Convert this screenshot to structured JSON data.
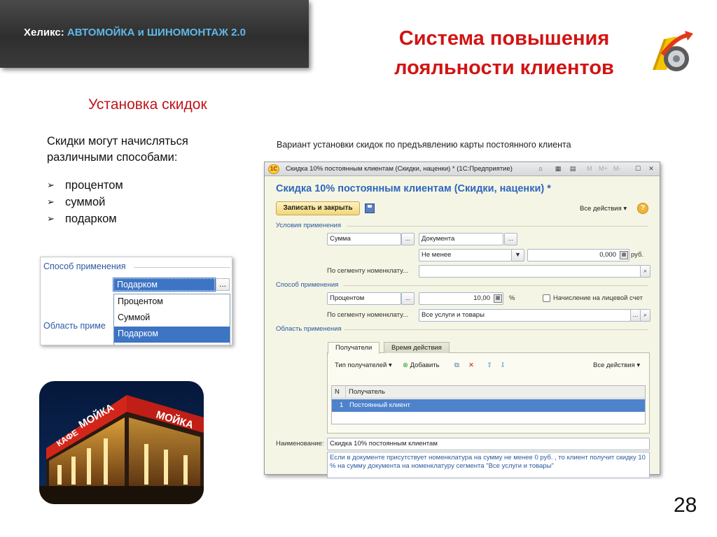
{
  "header": {
    "brand": "Хеликс:",
    "product": "АВТОМОЙКА и ШИНОМОНТАЖ 2.0",
    "title_line1": "Система повышения",
    "title_line2": "лояльности клиентов"
  },
  "slide": {
    "section_title": "Установка скидок",
    "lead": "Скидки могут начисляться различными способами:",
    "methods": [
      "процентом",
      "суммой",
      "подарком"
    ],
    "caption": "Вариант установки скидок по предъявлению карты постоянного клиента",
    "page_number": "28"
  },
  "snippet": {
    "legend": "Способ применения",
    "legend2": "Область приме",
    "selected": "Подарком",
    "dots": "...",
    "options": [
      "Процентом",
      "Суммой",
      "Подарком"
    ]
  },
  "photo": {
    "sign1": "МОЙКА",
    "sign2": "КАФЕ",
    "sign3": "МОЙКА"
  },
  "window": {
    "app_icon": "1С",
    "title": "Скидка 10% постоянным клиентам (Скидки, наценки) * (1С:Предприятие)",
    "mode_buttons": [
      "M",
      "M+",
      "M-"
    ],
    "form_title": "Скидка 10% постоянным клиентам (Скидки, наценки) *",
    "save_close": "Записать и закрыть",
    "all_actions": "Все действия",
    "help": "?",
    "conditions": {
      "legend": "Условия применения",
      "field_sum": "Сумма",
      "field_document": "Документа",
      "field_compare": "Не менее",
      "amount": "0,000",
      "currency": "руб.",
      "segment_label": "По сегменту номенклату...",
      "segment_value": ""
    },
    "method": {
      "legend": "Способ применения",
      "field_method": "Процентом",
      "value": "10,00",
      "unit": "%",
      "checkbox_label": "Начисление на лицевой счет",
      "segment_label": "По сегменту номенклату...",
      "segment_value": "Все услуги и товары"
    },
    "scope": {
      "legend": "Область применения",
      "tabs": [
        "Получатели",
        "Время действия"
      ],
      "recipient_type": "Тип получателей",
      "add": "Добавить",
      "all_actions": "Все действия",
      "columns": [
        "N",
        "Получатель"
      ],
      "rows": [
        {
          "n": "1",
          "recipient": "Постоянный клиент"
        }
      ]
    },
    "name_label": "Наименование:",
    "name_value": "Скидка 10% постоянным клиентам",
    "description": "Если в документе присутствует номенклатура на сумму не менее 0 руб. , то клиент получит скидку 10 % на сумму документа на номенклатуру сегмента \"Все услуги и товары\""
  },
  "colors": {
    "accent_red": "#d21414",
    "brand_blue": "#5fb8e8",
    "form_blue": "#2e66bd",
    "selection": "#4e82cb"
  }
}
